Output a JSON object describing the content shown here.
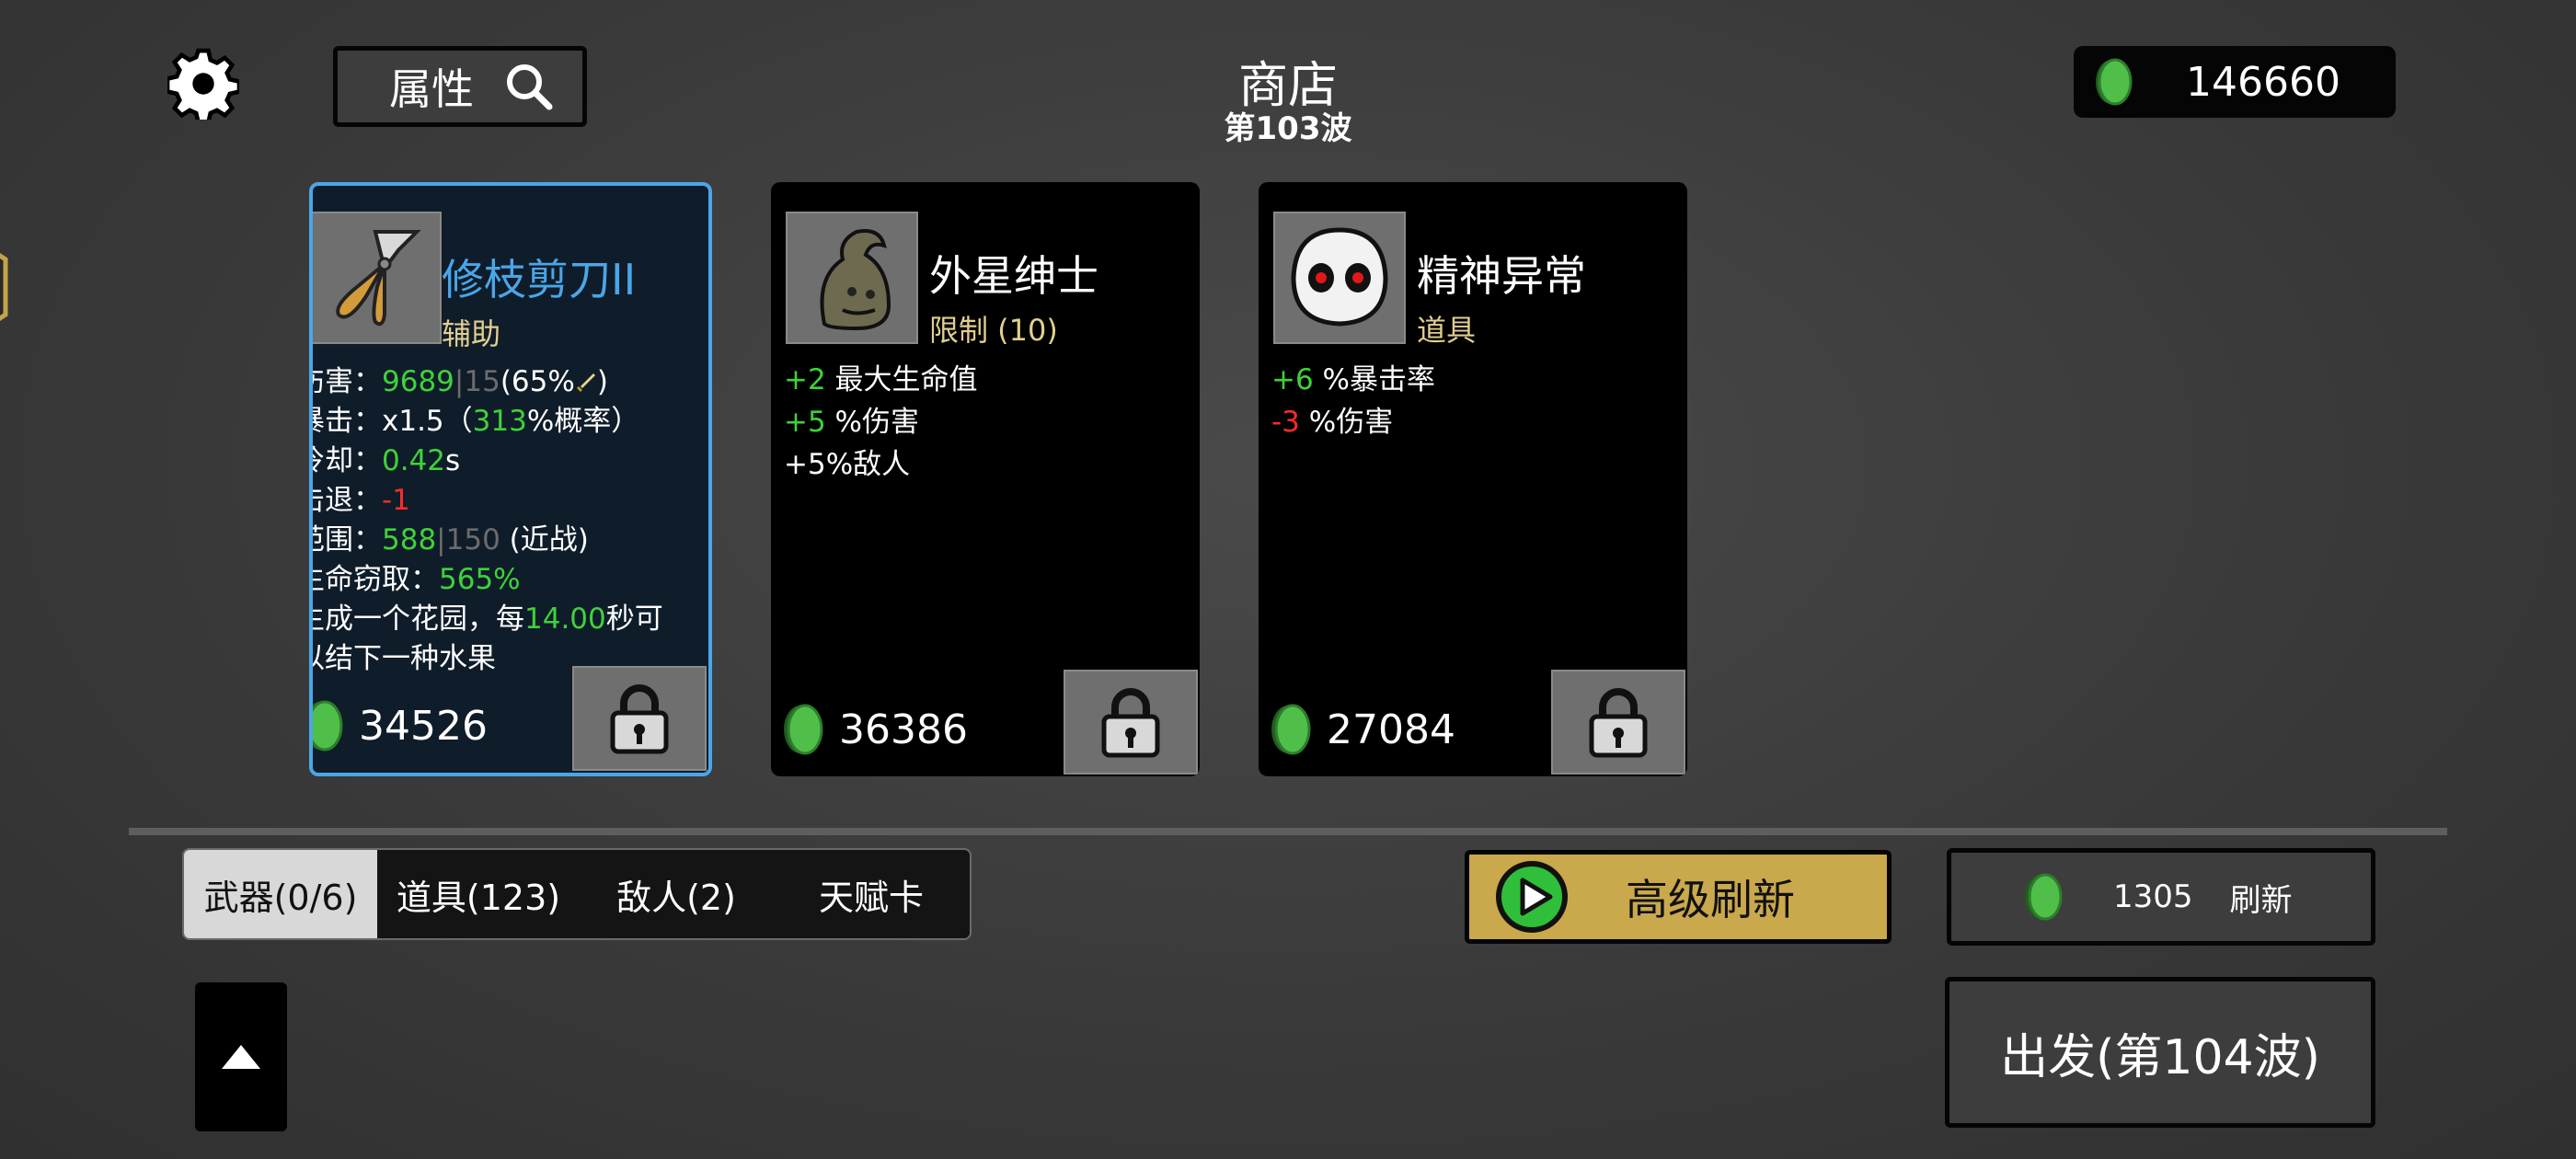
{
  "header": {
    "title": "商店",
    "wave": "第103波",
    "attr_label": "属性",
    "money": "146660"
  },
  "cards": [
    {
      "name": "修枝剪刀II",
      "type": "辅助",
      "stats": {
        "damage_label": "伤害：",
        "damage_value": "9689",
        "damage_sep": "|",
        "damage_base": "15",
        "damage_scale": "(65%",
        "damage_close": ")",
        "crit_label": "暴击：",
        "crit_mult": "x1.5（",
        "crit_chance": "313",
        "crit_suffix": "%概率）",
        "cd_label": "冷却：",
        "cd_value": "0.42",
        "cd_unit": "s",
        "kb_label": "击退：",
        "kb_value": "-1",
        "range_label": "范围：",
        "range_value": "588",
        "range_sep": "|",
        "range_base": "150",
        "range_type": " (近战)",
        "leech_label": "生命窃取：",
        "leech_value": "565%",
        "desc1_a": "生成一个花园，每",
        "desc1_num": "14.00",
        "desc1_b": "秒可",
        "desc2": "以结下一种水果"
      },
      "price": "34526"
    },
    {
      "name": "外星绅士",
      "type": "限制 (10)",
      "effects": [
        {
          "num": "+2",
          "text": " 最大生命值"
        },
        {
          "num": "+5",
          "text": " %伤害"
        },
        {
          "num": "",
          "text": "+5%敌人"
        }
      ],
      "price": "36386"
    },
    {
      "name": "精神异常",
      "type": "道具",
      "effects": [
        {
          "num": "+6",
          "text": " %暴击率"
        },
        {
          "num": "-3",
          "text": " %伤害"
        }
      ],
      "price": "27084"
    }
  ],
  "tabs": [
    "武器(0/6)",
    "道具(123)",
    "敌人(2)",
    "天赋卡"
  ],
  "buttons": {
    "advanced_refresh": "高级刷新",
    "refresh_cost": "1305",
    "refresh": "刷新",
    "go": "出发(第104波)"
  },
  "colors": {
    "positive": "#3fd23a",
    "negative": "#ff2a2a",
    "selected_border": "#4aa6e8",
    "selected_name": "#4aa6e8",
    "gold_button": "#caa84c",
    "coin": "#4fbf4a"
  },
  "icons": [
    "gear-icon",
    "search-icon",
    "coin-icon",
    "lock-icon",
    "play-icon",
    "arrow-up-icon"
  ]
}
